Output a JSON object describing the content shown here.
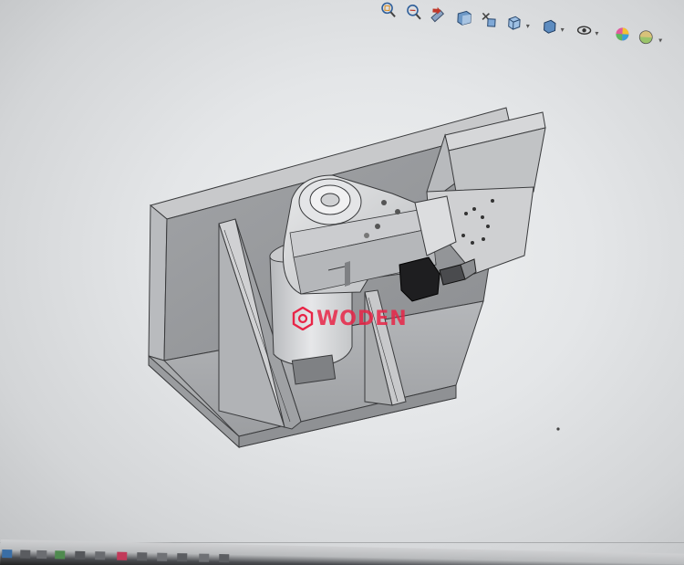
{
  "watermark": {
    "text": "WODEN",
    "color": "#e82446"
  },
  "heads_up_toolbar": {
    "buttons": [
      {
        "name": "zoom-to-fit-icon"
      },
      {
        "name": "zoom-to-area-icon"
      },
      {
        "name": "previous-view-icon"
      },
      {
        "name": "section-view-icon"
      },
      {
        "name": "dynamic-annotation-icon"
      },
      {
        "name": "view-orientation-icon"
      },
      {
        "name": "display-style-icon"
      },
      {
        "name": "hide-show-items-icon"
      },
      {
        "name": "edit-appearance-icon"
      },
      {
        "name": "apply-scene-icon"
      }
    ]
  },
  "taskbar": {
    "icons": [
      {
        "name": "taskbar-app-icon-1"
      },
      {
        "name": "taskbar-app-icon-2"
      },
      {
        "name": "taskbar-app-icon-3"
      },
      {
        "name": "taskbar-app-icon-4"
      },
      {
        "name": "taskbar-app-icon-5"
      },
      {
        "name": "taskbar-app-icon-6"
      },
      {
        "name": "taskbar-app-icon-7"
      },
      {
        "name": "taskbar-app-icon-8"
      },
      {
        "name": "taskbar-app-icon-9"
      },
      {
        "name": "taskbar-app-icon-10"
      },
      {
        "name": "taskbar-app-icon-11"
      },
      {
        "name": "taskbar-app-icon-12"
      }
    ]
  },
  "colors": {
    "viewport_background": "#e4e6e8",
    "model_light": "#c3c4c6",
    "model_mid": "#a9abad",
    "model_dark": "#8d8f92",
    "model_edge": "#3a3b3d",
    "motor_body": "#d8d9db",
    "sensor_black": "#1e1e20"
  }
}
